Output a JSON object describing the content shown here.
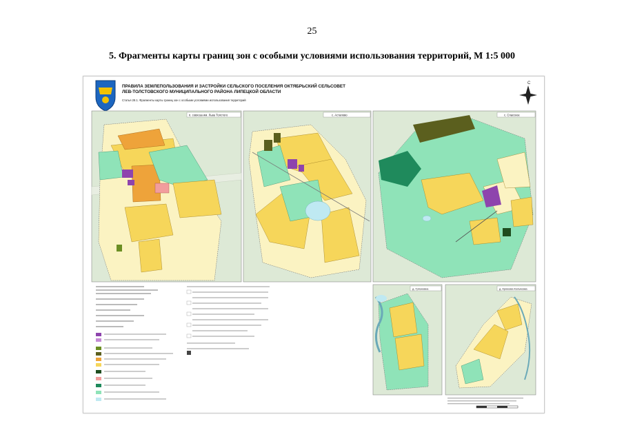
{
  "page_number": "25",
  "heading": "5.  Фрагменты карты границ зон с особыми условиями использования территорий, М 1:5 000",
  "map": {
    "title_line1": "ПРАВИЛА ЗЕМЛЕПОЛЬЗОВАНИЯ И ЗАСТРОЙКИ СЕЛЬСКОГО ПОСЕЛЕНИЯ ОКТЯБРЬСКИЙ СЕЛЬСОВЕТ",
    "title_line2": "ЛЕВ-ТОЛСТОВСКОГО МУНИЦИПАЛЬНОГО РАЙОНА ЛИПЕЦКОЙ ОБЛАСТИ",
    "subtitle": "Статья 28.1. Фрагменты карты границ зон с особыми условиями использования территорий",
    "compass_letter": "С",
    "panels": [
      {
        "label": "п. совхоза им. Льва Толстого"
      },
      {
        "label": "с. Астапово"
      },
      {
        "label": "с. Спасское"
      },
      {
        "label": "д. Грязновка"
      },
      {
        "label": "д. Крюкова Кольчевка"
      }
    ],
    "colors": {
      "residential_yellow": "#f6d65a",
      "residential_orange": "#eea33a",
      "green_zone": "#8fe3b8",
      "dark_green": "#1f8a5c",
      "olive": "#5b5f1e",
      "purple": "#8e44ad",
      "water": "#bfe9f2",
      "pale_yellow": "#fbf3c2",
      "background_green": "#dde9d6"
    }
  }
}
